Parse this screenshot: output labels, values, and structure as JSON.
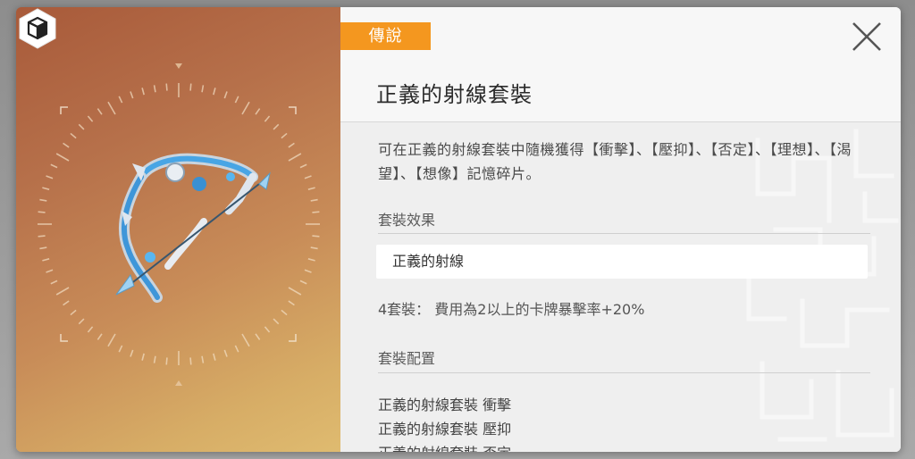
{
  "item": {
    "rarity": "傳說",
    "title": "正義的射線套裝",
    "description": "可在正義的射線套裝中隨機獲得【衝擊】、【壓抑】、【否定】、【理想】、【渴望】、【想像】記憶碎片。",
    "icon": "bow-weapon-art"
  },
  "set_effect": {
    "label": "套裝效果",
    "name": "正義的射線",
    "bonus": "4套裝： 費用為2以上的卡牌暴擊率+20%"
  },
  "set_config": {
    "label": "套裝配置",
    "pieces": [
      "正義的射線套裝 衝擊",
      "正義的射線套裝 壓抑",
      "正義的射線套裝 否定"
    ]
  },
  "colors": {
    "rarity_orange": "#f4971f",
    "art_top": "#a85a3a",
    "art_bottom": "#dfbb70",
    "panel_bg": "#f2f2f2"
  }
}
